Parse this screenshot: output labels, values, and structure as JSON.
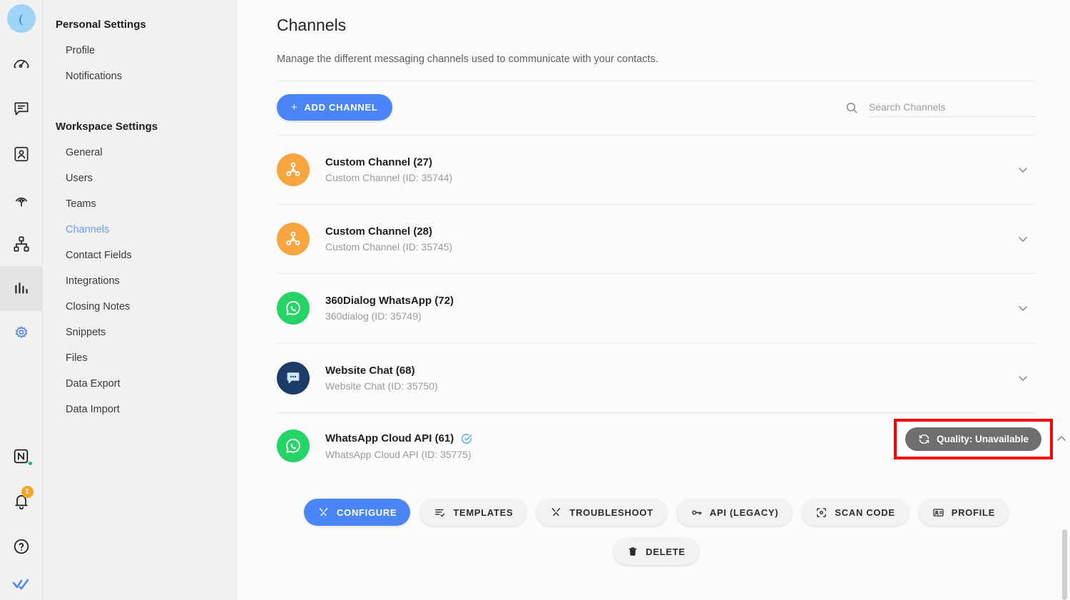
{
  "rail": {
    "avatar_label": "(",
    "items": [
      {
        "name": "dashboard",
        "icon": "speedometer-icon",
        "active": false
      },
      {
        "name": "messages",
        "icon": "chat-icon",
        "active": false
      },
      {
        "name": "contacts",
        "icon": "contact-card-icon",
        "active": false
      },
      {
        "name": "broadcasts",
        "icon": "broadcast-icon",
        "active": false
      },
      {
        "name": "flows",
        "icon": "sitemap-icon",
        "active": false
      },
      {
        "name": "reports",
        "icon": "bar-chart-icon",
        "active": true
      },
      {
        "name": "settings",
        "icon": "gear-icon",
        "active": false
      }
    ],
    "bottom_items": [
      {
        "name": "notion",
        "icon": "notion-icon",
        "badge": ""
      },
      {
        "name": "notifications",
        "icon": "bell-icon",
        "badge": "1"
      },
      {
        "name": "help",
        "icon": "question-circle-icon",
        "badge": ""
      },
      {
        "name": "brand",
        "icon": "double-check-icon",
        "badge": ""
      }
    ]
  },
  "nav": {
    "personal_title": "Personal Settings",
    "personal_items": [
      {
        "label": "Profile",
        "active": false
      },
      {
        "label": "Notifications",
        "active": false
      }
    ],
    "workspace_title": "Workspace Settings",
    "workspace_items": [
      {
        "label": "General",
        "active": false
      },
      {
        "label": "Users",
        "active": false
      },
      {
        "label": "Teams",
        "active": false
      },
      {
        "label": "Channels",
        "active": true
      },
      {
        "label": "Contact Fields",
        "active": false
      },
      {
        "label": "Integrations",
        "active": false
      },
      {
        "label": "Closing Notes",
        "active": false
      },
      {
        "label": "Snippets",
        "active": false
      },
      {
        "label": "Files",
        "active": false
      },
      {
        "label": "Data Export",
        "active": false
      },
      {
        "label": "Data Import",
        "active": false
      }
    ]
  },
  "page": {
    "title": "Channels",
    "subtitle": "Manage the different messaging channels used to communicate with your contacts."
  },
  "toolbar": {
    "add_channel_label": "ADD CHANNEL",
    "add_channel_plus": "+",
    "search_placeholder": "Search Channels",
    "search_value": ""
  },
  "channels": [
    {
      "name": "Custom Channel (27)",
      "desc": "Custom Channel (ID: 35744)",
      "avatar": "orange",
      "icon": "network-nodes-icon",
      "verified": false,
      "expanded": false
    },
    {
      "name": "Custom Channel (28)",
      "desc": "Custom Channel (ID: 35745)",
      "avatar": "orange",
      "icon": "network-nodes-icon",
      "verified": false,
      "expanded": false
    },
    {
      "name": "360Dialog WhatsApp (72)",
      "desc": "360dialog (ID: 35749)",
      "avatar": "green",
      "icon": "whatsapp-icon",
      "verified": false,
      "expanded": false
    },
    {
      "name": "Website Chat (68)",
      "desc": "Website Chat (ID: 35750)",
      "avatar": "navy",
      "icon": "chat-bubble-icon",
      "verified": false,
      "expanded": false
    }
  ],
  "expanded_channel": {
    "name": "WhatsApp Cloud API (61)",
    "desc": "WhatsApp Cloud API (ID: 35775)",
    "avatar": "green",
    "icon": "whatsapp-icon",
    "verified": true,
    "verified_icon": "check-circle-icon",
    "quality_label": "Quality: Unavailable",
    "quality_icon": "refresh-icon",
    "highlight_color": "#ff0000",
    "actions": [
      {
        "label": "CONFIGURE",
        "icon": "wrench-icon",
        "primary": true
      },
      {
        "label": "TEMPLATES",
        "icon": "list-check-icon",
        "primary": false
      },
      {
        "label": "TROUBLESHOOT",
        "icon": "wrench-icon",
        "primary": false
      },
      {
        "label": "API (LEGACY)",
        "icon": "key-icon",
        "primary": false
      },
      {
        "label": "SCAN CODE",
        "icon": "qr-scan-icon",
        "primary": false
      },
      {
        "label": "PROFILE",
        "icon": "id-card-icon",
        "primary": false
      }
    ],
    "delete": {
      "label": "DELETE",
      "icon": "trash-icon"
    }
  },
  "colors": {
    "accent": "#4a86f7",
    "orange": "#f7a541",
    "whatsapp_green": "#25d366",
    "navy": "#1b3c66",
    "quality_gray": "#6e6e6e",
    "highlight_red": "#ff0000"
  }
}
